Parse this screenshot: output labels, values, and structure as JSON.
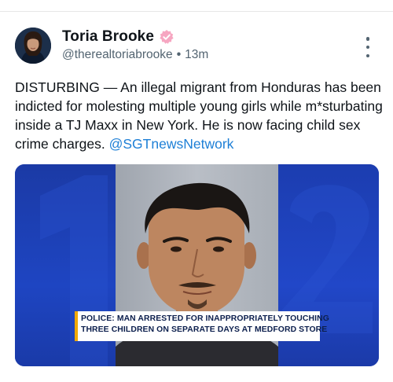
{
  "post": {
    "author_name": "Toria Brooke",
    "verified_icon": "verified-badge-icon",
    "handle": "@therealtoriabrooke",
    "separator": "•",
    "time": "13m",
    "more_icon": "more-vertical-icon",
    "text_main": "DISTURBING — An illegal migrant from Honduras has been indicted for molesting multiple young girls while m*sturbating inside a TJ Maxx in New York. He is now facing child sex crime charges. ",
    "mention": "@SGTnewsNetwork"
  },
  "media": {
    "chyron_line1": "POLICE: MAN ARRESTED FOR INAPPROPRIATELY TOUCHING",
    "chyron_line2": "THREE CHILDREN ON SEPARATE DAYS AT MEDFORD STORE",
    "accent_color": "#f2a900",
    "brand_color": "#1e45c2"
  },
  "colors": {
    "verified": "#f6a6c1",
    "link": "#1d7fd6",
    "muted": "#536471"
  }
}
